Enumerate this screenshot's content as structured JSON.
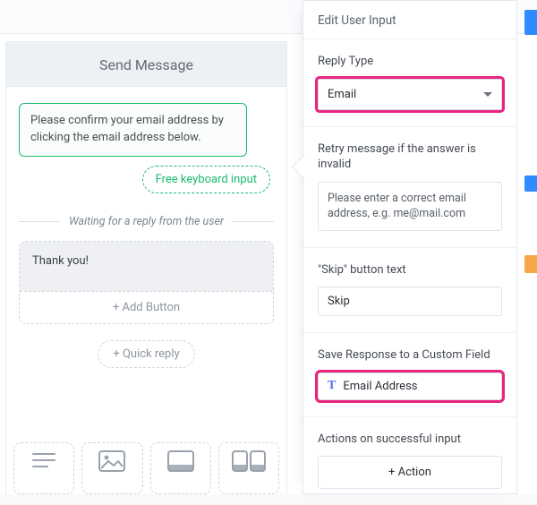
{
  "topbar": {},
  "left": {
    "header": "Send Message",
    "confirm_text": "Please confirm your email address by clicking the email address below.",
    "free_input_label": "Free keyboard input",
    "waiting_text": "Waiting for a reply from the user",
    "thank_you_text": "Thank you!",
    "add_button_label": "+ Add Button",
    "quick_reply_label": "+ Quick reply"
  },
  "panel": {
    "title": "Edit User Input",
    "reply_type": {
      "label": "Reply Type",
      "value": "Email"
    },
    "retry": {
      "label": "Retry message if the answer is invalid",
      "value": "Please enter a correct email address, e.g. me@mail.com"
    },
    "skip": {
      "label": "\"Skip\" button text",
      "value": "Skip"
    },
    "custom_field": {
      "label": "Save Response to a Custom Field",
      "value": "Email Address"
    },
    "actions": {
      "label": "Actions on successful input",
      "button": "+ Action"
    }
  },
  "colors": {
    "accent_green": "#1abc6f",
    "highlight_pink": "#e8247e",
    "blue": "#2f8bff",
    "orange": "#f5a84a"
  }
}
